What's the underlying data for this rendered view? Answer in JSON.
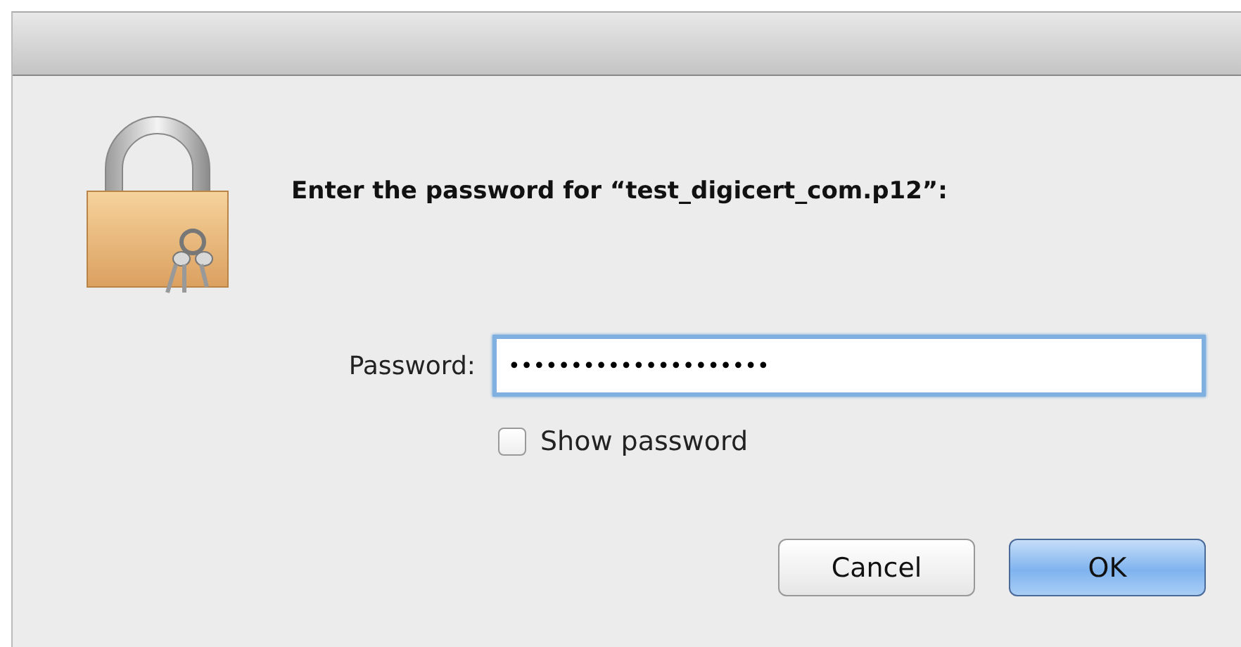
{
  "dialog": {
    "message": "Enter the password for “test_digicert_com.p12”:",
    "password": {
      "label": "Password:",
      "value": "•••••••••••••••••••••",
      "focused": true
    },
    "show_password": {
      "label": "Show password",
      "checked": false
    },
    "buttons": [
      {
        "label": "Cancel",
        "default": false
      },
      {
        "label": "OK",
        "default": true
      }
    ]
  }
}
